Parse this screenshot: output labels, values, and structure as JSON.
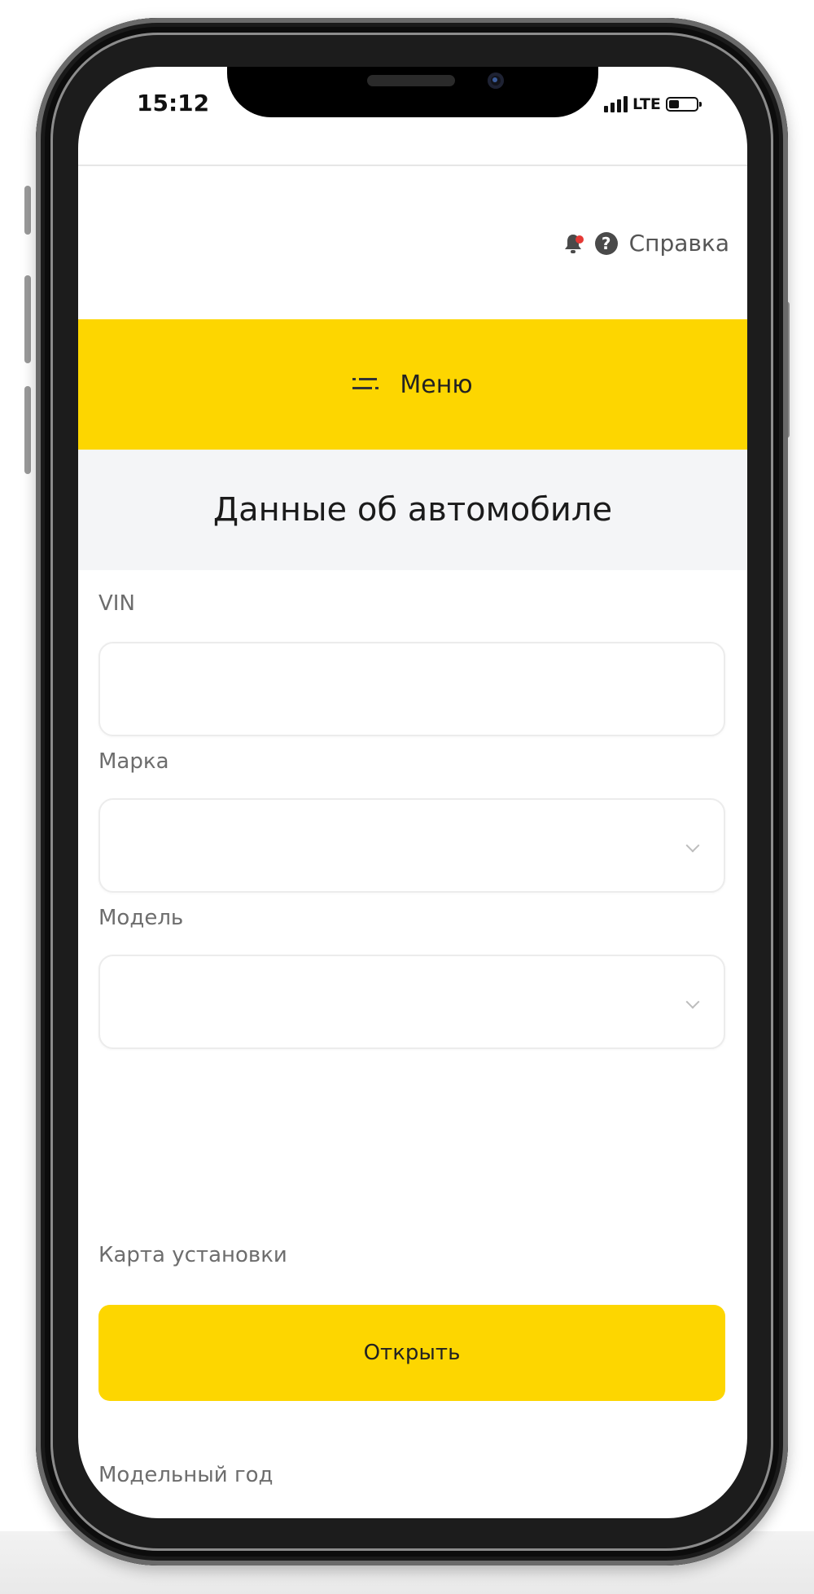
{
  "status_bar": {
    "time": "15:12",
    "network": "LTE"
  },
  "header": {
    "bell_icon": "bell-icon",
    "notification_dot_color": "#e53935",
    "help_icon": "question-circle-icon",
    "help_label": "Справка"
  },
  "menu": {
    "icon": "menu-lines-icon",
    "label": "Меню",
    "background": "#fdd600"
  },
  "page": {
    "title": "Данные об автомобиле"
  },
  "form": {
    "vin": {
      "label": "VIN",
      "value": ""
    },
    "brand": {
      "label": "Марка",
      "value": ""
    },
    "model": {
      "label": "Модель",
      "value": ""
    },
    "install_map": {
      "label": "Карта установки",
      "button_label": "Открыть"
    },
    "model_year": {
      "label": "Модельный год"
    }
  },
  "colors": {
    "accent": "#fdd600",
    "title_band": "#f4f5f7"
  }
}
